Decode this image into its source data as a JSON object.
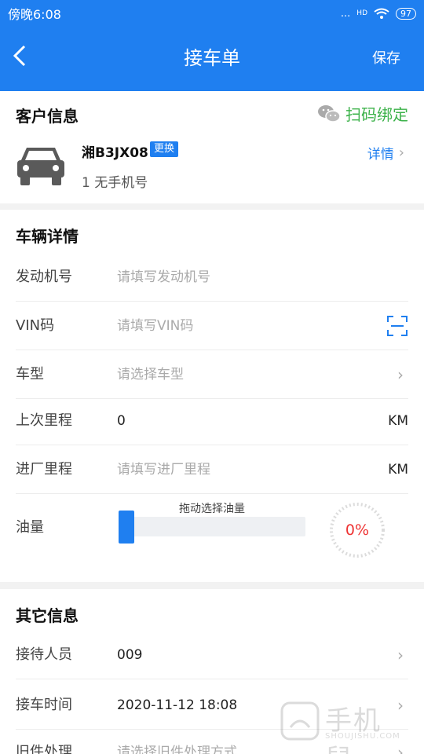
{
  "status_bar": {
    "time": "傍晚6:08",
    "signal": "...",
    "network": "HD",
    "battery": "97"
  },
  "nav": {
    "back_icon": "chevron-left-icon",
    "title": "接车单",
    "save_label": "保存"
  },
  "customer": {
    "section_title": "客户信息",
    "wechat_label": "扫码绑定",
    "plate": "湘B3JX08",
    "change_label": "更换",
    "phone_text": "1 无手机号",
    "detail_label": "详情"
  },
  "vehicle": {
    "section_title": "车辆详情",
    "engine": {
      "label": "发动机号",
      "placeholder": "请填写发动机号"
    },
    "vin": {
      "label": "VIN码",
      "placeholder": "请填写VIN码"
    },
    "model": {
      "label": "车型",
      "placeholder": "请选择车型"
    },
    "last_mileage": {
      "label": "上次里程",
      "value": "0",
      "unit": "KM"
    },
    "entry_mileage": {
      "label": "进厂里程",
      "placeholder": "请填写进厂里程",
      "unit": "KM"
    },
    "fuel": {
      "label": "油量",
      "hint": "拖动选择油量",
      "percent_text": "0%",
      "level": 0
    }
  },
  "other": {
    "section_title": "其它信息",
    "receiver": {
      "label": "接待人员",
      "value": "009"
    },
    "pickup_time": {
      "label": "接车时间",
      "value": "2020-11-12 18:08"
    },
    "old_parts": {
      "label": "旧件处理",
      "placeholder": "请选择旧件处理方式"
    }
  },
  "watermark": {
    "text": "手机鼠",
    "sub": "SHOUJISHU.COM"
  },
  "colors": {
    "primary": "#1f7ff0",
    "wechat": "#3cb24a",
    "alert": "#e33333"
  }
}
